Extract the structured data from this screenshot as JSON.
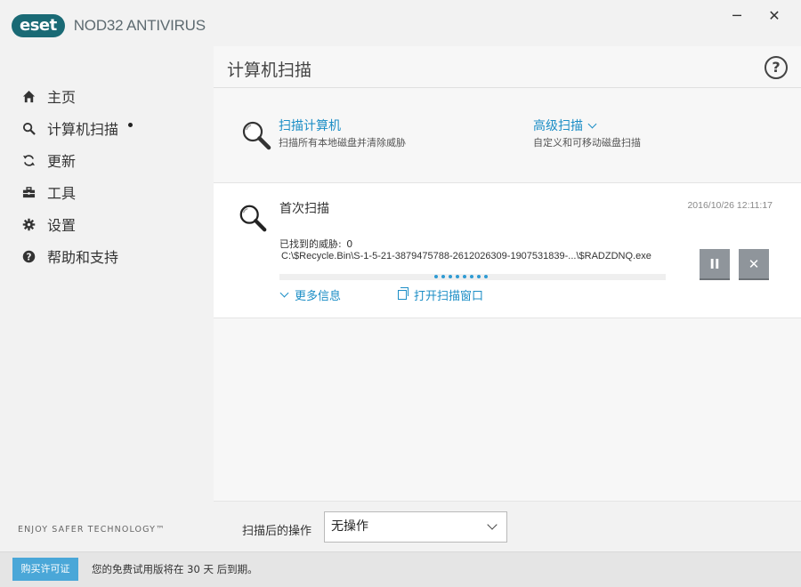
{
  "brand": {
    "logo_text": "eset",
    "product": "NOD32 ANTIVIRUS"
  },
  "window": {
    "minimize": "─",
    "close": "✕"
  },
  "sidebar": {
    "items": [
      {
        "label": "主页",
        "icon": "home-icon"
      },
      {
        "label": "计算机扫描",
        "icon": "search-icon",
        "active": true
      },
      {
        "label": "更新",
        "icon": "refresh-icon"
      },
      {
        "label": "工具",
        "icon": "toolbox-icon"
      },
      {
        "label": "设置",
        "icon": "gear-icon"
      },
      {
        "label": "帮助和支持",
        "icon": "help-circle-icon"
      }
    ],
    "tagline": "ENJOY SAFER TECHNOLOGY™"
  },
  "main": {
    "title": "计算机扫描",
    "help": "?",
    "actions": {
      "scan": {
        "title": "扫描计算机",
        "desc": "扫描所有本地磁盘并清除威胁"
      },
      "advanced": {
        "title": "高级扫描",
        "desc": "自定义和可移动磁盘扫描"
      }
    },
    "scan_card": {
      "name": "首次扫描",
      "timestamp": "2016/10/26 12:11:17",
      "threats_label": "已找到的威胁:",
      "threats_count": "0",
      "path": "C:\\$Recycle.Bin\\S-1-5-21-3879475788-2612026309-1907531839-...\\$RADZDNQ.exe",
      "pause": "II",
      "stop": "✕",
      "more_info": "更多信息",
      "open_window": "打开扫描窗口"
    },
    "after_scan": {
      "label": "扫描后的操作",
      "selected": "无操作"
    }
  },
  "status": {
    "buy": "购买许可证",
    "trial": "您的免费试用版将在 30 天 后到期。"
  },
  "colors": {
    "accent": "#1c8ec6",
    "brand": "#1a6a75",
    "buy": "#4aa7d8"
  }
}
